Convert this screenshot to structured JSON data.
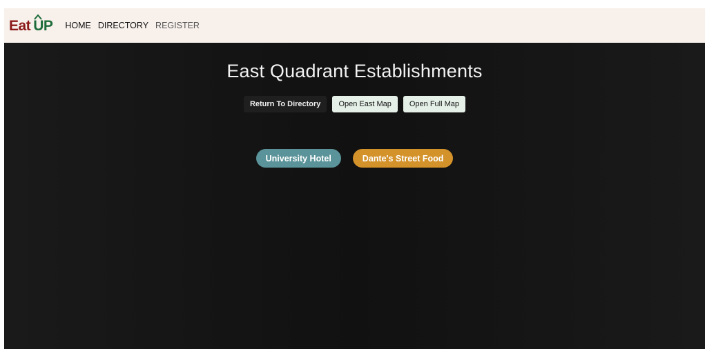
{
  "brand": {
    "logo_eat": "Eat",
    "logo_up": "UP",
    "colors": {
      "eat": "#8b1a1a",
      "up": "#1e6b3a"
    }
  },
  "nav": {
    "items": [
      {
        "label": "HOME"
      },
      {
        "label": "DIRECTORY"
      },
      {
        "label": "REGISTER"
      }
    ]
  },
  "main": {
    "title": "East Quadrant Establishments",
    "buttons": {
      "return_directory": "Return To Directory",
      "open_east_map": "Open East Map",
      "open_full_map": "Open Full Map"
    },
    "establishments": [
      {
        "name": "University Hotel",
        "color": "#5a9399"
      },
      {
        "name": "Dante's Street Food",
        "color": "#d4922a"
      }
    ]
  }
}
